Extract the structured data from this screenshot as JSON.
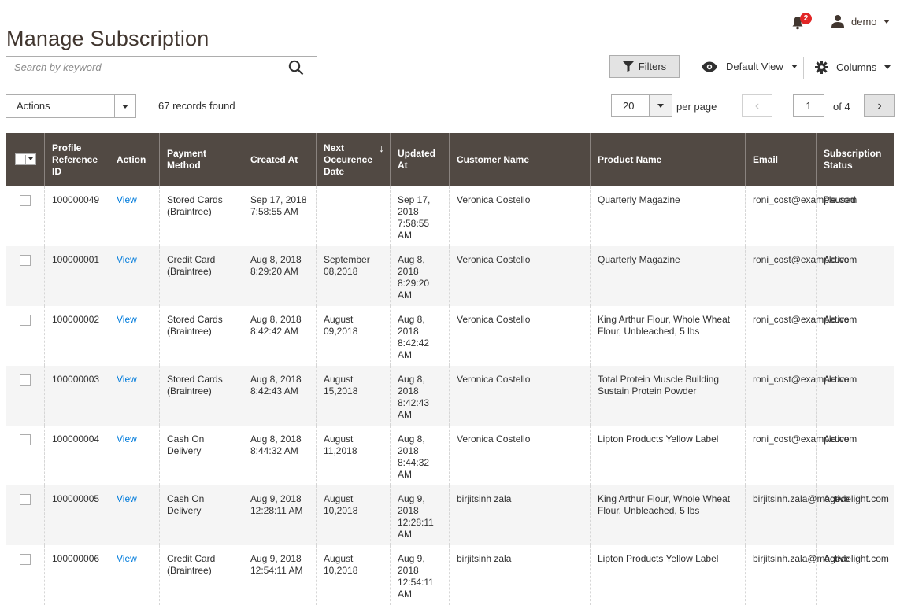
{
  "header": {
    "title": "Manage Subscription",
    "notifications_count": "2",
    "user_name": "demo"
  },
  "toolbar": {
    "search_placeholder": "Search by keyword",
    "filters_label": "Filters",
    "view_label": "Default View",
    "columns_label": "Columns",
    "actions_label": "Actions",
    "records_found": "67 records found",
    "per_page_value": "20",
    "per_page_label": "per page",
    "current_page": "1",
    "of_pages": "of 4"
  },
  "table": {
    "columns": [
      "Profile Reference ID",
      "Action",
      "Payment Method",
      "Created At",
      "Next Occurence Date",
      "Updated At",
      "Customer Name",
      "Product Name",
      "Email",
      "Subscription Status"
    ],
    "sort_arrow": "↓",
    "rows": [
      {
        "id": "100000049",
        "action": "View",
        "payment": "Stored Cards (Braintree)",
        "created": "Sep 17, 2018 7:58:55 AM",
        "next": "",
        "updated": "Sep 17, 2018 7:58:55 AM",
        "customer": "Veronica Costello",
        "product": "Quarterly Magazine",
        "email": "roni_cost@example.com",
        "status": "Paused"
      },
      {
        "id": "100000001",
        "action": "View",
        "payment": "Credit Card (Braintree)",
        "created": "Aug 8, 2018 8:29:20 AM",
        "next": "September 08,2018",
        "updated": "Aug 8, 2018 8:29:20 AM",
        "customer": "Veronica Costello",
        "product": "Quarterly Magazine",
        "email": "roni_cost@example.com",
        "status": "Active"
      },
      {
        "id": "100000002",
        "action": "View",
        "payment": "Stored Cards (Braintree)",
        "created": "Aug 8, 2018 8:42:42 AM",
        "next": "August 09,2018",
        "updated": "Aug 8, 2018 8:42:42 AM",
        "customer": "Veronica Costello",
        "product": "King Arthur Flour, Whole Wheat Flour, Unbleached, 5 lbs",
        "email": "roni_cost@example.com",
        "status": "Active"
      },
      {
        "id": "100000003",
        "action": "View",
        "payment": "Stored Cards (Braintree)",
        "created": "Aug 8, 2018 8:42:43 AM",
        "next": "August 15,2018",
        "updated": "Aug 8, 2018 8:42:43 AM",
        "customer": "Veronica Costello",
        "product": "Total Protein Muscle Building Sustain Protein Powder",
        "email": "roni_cost@example.com",
        "status": "Active"
      },
      {
        "id": "100000004",
        "action": "View",
        "payment": "Cash On Delivery",
        "created": "Aug 8, 2018 8:44:32 AM",
        "next": "August 11,2018",
        "updated": "Aug 8, 2018 8:44:32 AM",
        "customer": "Veronica Costello",
        "product": "Lipton Products Yellow Label",
        "email": "roni_cost@example.com",
        "status": "Active"
      },
      {
        "id": "100000005",
        "action": "View",
        "payment": "Cash On Delivery",
        "created": "Aug 9, 2018 12:28:11 AM",
        "next": "August 10,2018",
        "updated": "Aug 9, 2018 12:28:11 AM",
        "customer": "birjitsinh zala",
        "product": "King Arthur Flour, Whole Wheat Flour, Unbleached, 5 lbs",
        "email": "birjitsinh.zala@magedelight.com",
        "status": "Active"
      },
      {
        "id": "100000006",
        "action": "View",
        "payment": "Credit Card (Braintree)",
        "created": "Aug 9, 2018 12:54:11 AM",
        "next": "August 10,2018",
        "updated": "Aug 9, 2018 12:54:11 AM",
        "customer": "birjitsinh zala",
        "product": "Lipton Products Yellow Label",
        "email": "birjitsinh.zala@magedelight.com",
        "status": "Active"
      }
    ]
  }
}
